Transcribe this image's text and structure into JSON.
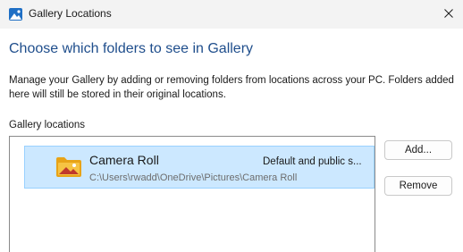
{
  "window": {
    "title": "Gallery Locations",
    "close_icon": "close-icon",
    "app_icon": "gallery-icon"
  },
  "main": {
    "heading": "Choose which folders to see in Gallery",
    "description": "Manage your Gallery by adding or removing folders from locations across your PC. Folders added here will still be stored in their original locations.",
    "locations_label": "Gallery locations"
  },
  "locations": {
    "items": [
      {
        "name": "Camera Roll",
        "path": "C:\\Users\\rwadd\\OneDrive\\Pictures\\Camera Roll",
        "status": "Default and public s...",
        "icon": "folder-photo-icon",
        "selected": true
      }
    ]
  },
  "buttons": {
    "add_label": "Add...",
    "remove_label": "Remove"
  },
  "colors": {
    "accent_heading": "#1f4e8c",
    "selection_background": "#cce8ff",
    "selection_border": "#99d1ff",
    "titlebar_background": "#f3f3f3"
  }
}
